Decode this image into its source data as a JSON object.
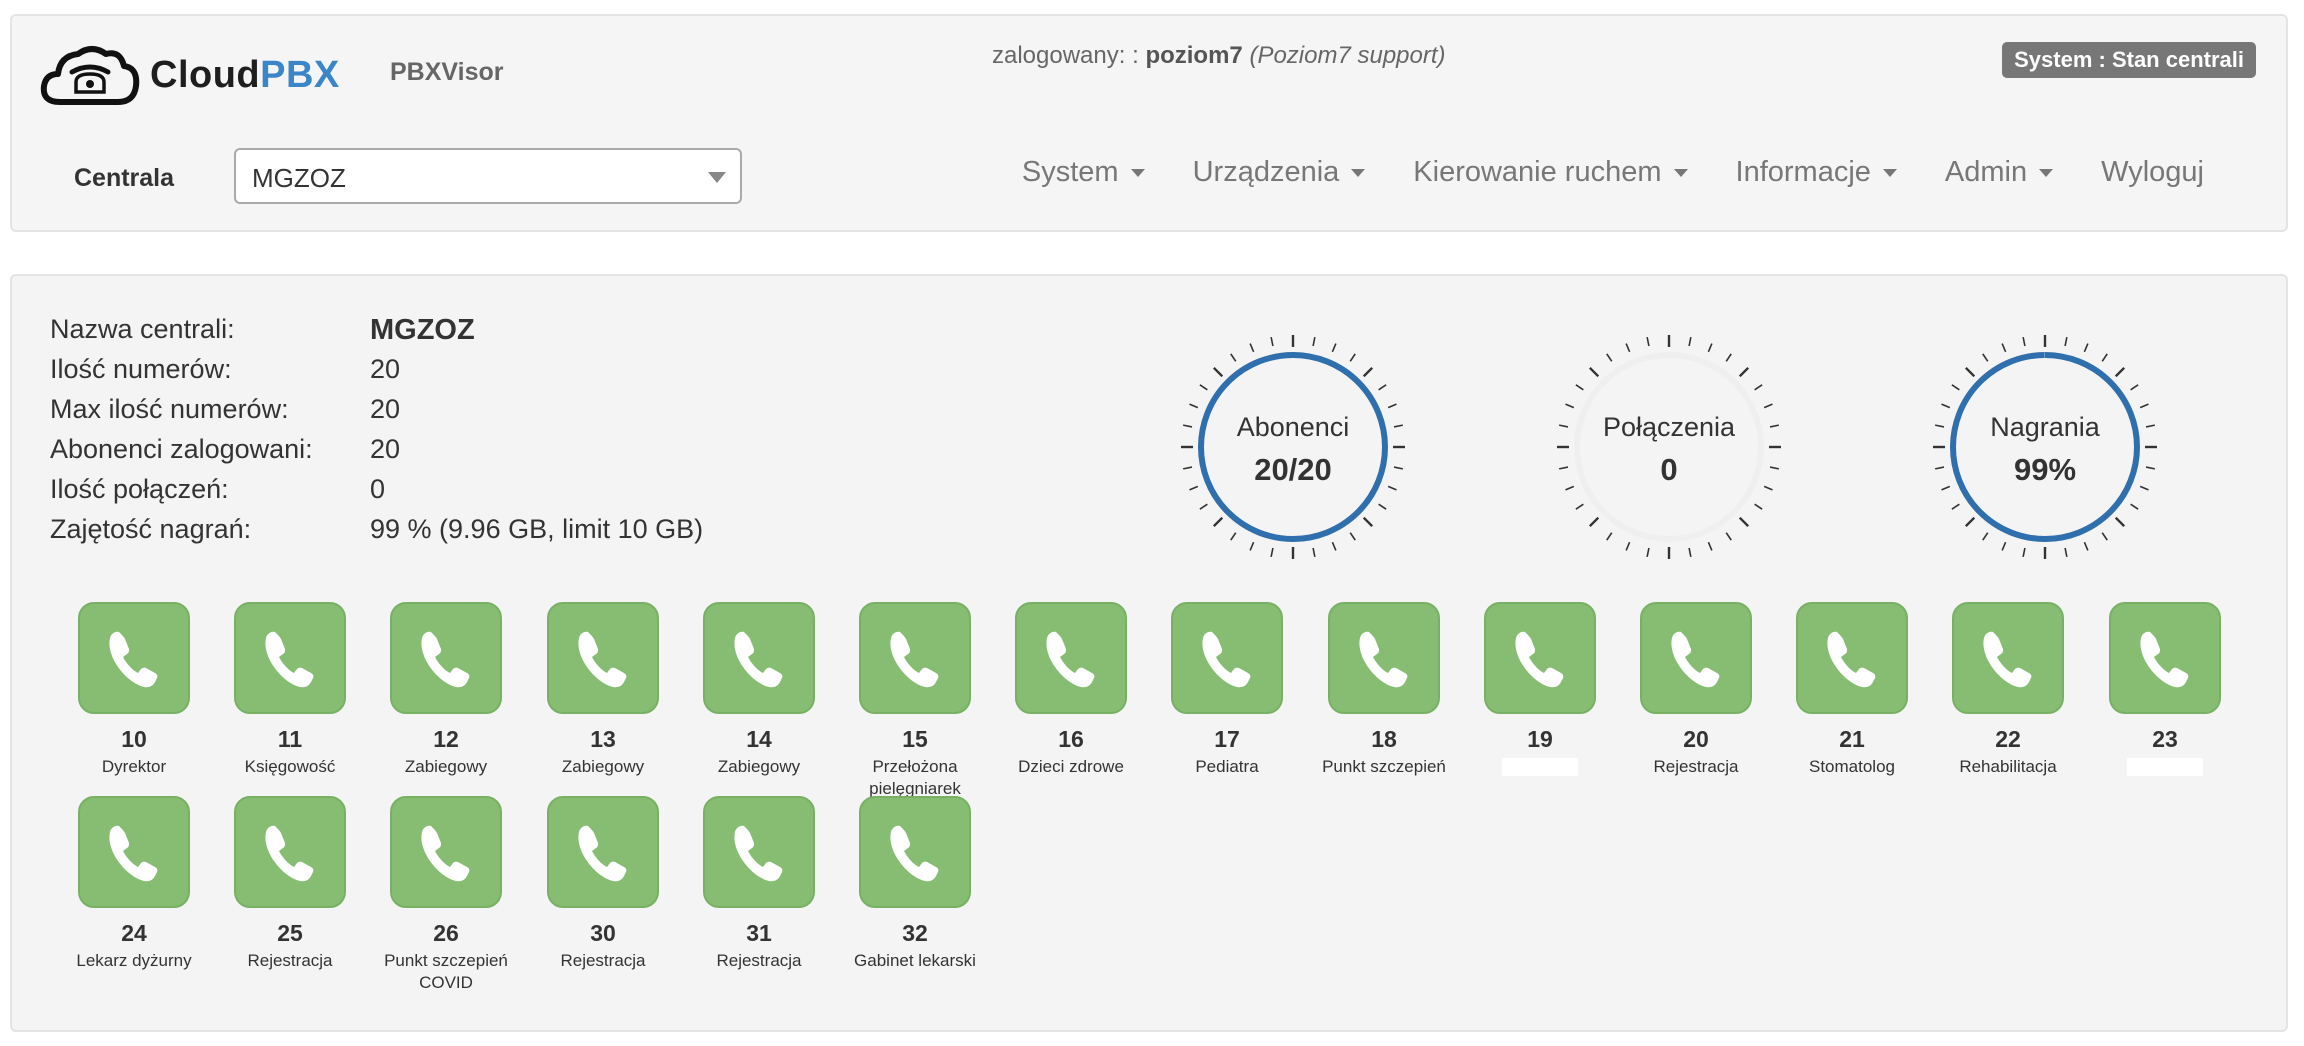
{
  "header": {
    "logo": {
      "cloud": "Cloud",
      "pbx": "PBX"
    },
    "app_name": "PBXVisor",
    "login": {
      "prefix": "zalogowany: :",
      "user": "poziom7",
      "role": "(Poziom7 support)"
    },
    "status_badge": "System : Stan centrali",
    "centrala_label": "Centrala",
    "centrala_value": "MGZOZ",
    "nav": [
      {
        "label": "System",
        "dropdown": true
      },
      {
        "label": "Urządzenia",
        "dropdown": true
      },
      {
        "label": "Kierowanie ruchem",
        "dropdown": true
      },
      {
        "label": "Informacje",
        "dropdown": true
      },
      {
        "label": "Admin",
        "dropdown": true
      },
      {
        "label": "Wyloguj",
        "dropdown": false
      }
    ]
  },
  "info": [
    {
      "key": "Nazwa centrali:",
      "value": "MGZOZ",
      "bold": true
    },
    {
      "key": "Ilość numerów:",
      "value": "20",
      "bold": false
    },
    {
      "key": "Max ilość numerów:",
      "value": "20",
      "bold": false
    },
    {
      "key": "Abonenci zalogowani:",
      "value": "20",
      "bold": false
    },
    {
      "key": "Ilość połączeń:",
      "value": "0",
      "bold": false
    },
    {
      "key": "Zajętość nagrań:",
      "value": "99 % (9.96 GB, limit 10 GB)",
      "bold": false
    }
  ],
  "gauges": [
    {
      "label": "Abonenci",
      "value": "20/20",
      "fill_fraction": 1.0
    },
    {
      "label": "Połączenia",
      "value": "0",
      "fill_fraction": 0.0
    },
    {
      "label": "Nagrania",
      "value": "99%",
      "fill_fraction": 0.99
    }
  ],
  "extensions": [
    {
      "number": "10",
      "name": "Dyrektor"
    },
    {
      "number": "11",
      "name": "Księgowość"
    },
    {
      "number": "12",
      "name": "Zabiegowy"
    },
    {
      "number": "13",
      "name": "Zabiegowy"
    },
    {
      "number": "14",
      "name": "Zabiegowy"
    },
    {
      "number": "15",
      "name": "Przełożona pielęgniarek"
    },
    {
      "number": "16",
      "name": "Dzieci zdrowe"
    },
    {
      "number": "17",
      "name": "Pediatra"
    },
    {
      "number": "18",
      "name": "Punkt szczepień"
    },
    {
      "number": "19",
      "name": ""
    },
    {
      "number": "20",
      "name": "Rejestracja"
    },
    {
      "number": "21",
      "name": "Stomatolog"
    },
    {
      "number": "22",
      "name": "Rehabilitacja"
    },
    {
      "number": "23",
      "name": ""
    },
    {
      "number": "24",
      "name": "Lekarz dyżurny"
    },
    {
      "number": "25",
      "name": "Rejestracja"
    },
    {
      "number": "26",
      "name": "Punkt szczepień COVID"
    },
    {
      "number": "30",
      "name": "Rejestracja"
    },
    {
      "number": "31",
      "name": "Rejestracja"
    },
    {
      "number": "32",
      "name": "Gabinet lekarski"
    }
  ],
  "colors": {
    "gauge_ring": "#2f6fad",
    "phone_ok": "#86bd73",
    "badge": "#777777",
    "logo_accent": "#3a86c8"
  }
}
